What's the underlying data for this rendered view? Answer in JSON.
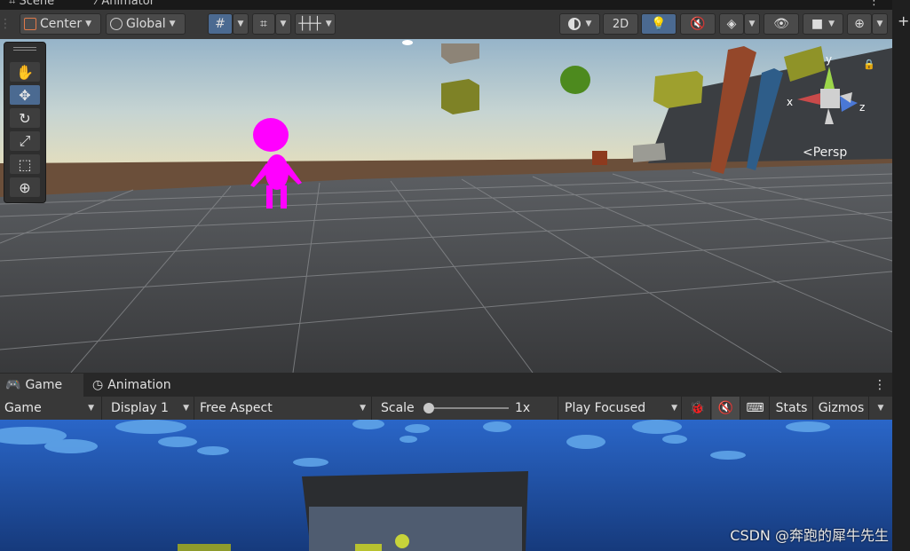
{
  "scene_tabs": {
    "scene_label": "Scene",
    "animator_label": "Animator"
  },
  "scene_toolbar": {
    "pivot_label": "Center",
    "space_label": "Global",
    "mode_2d_label": "2D"
  },
  "scene_view": {
    "projection_label": "Persp",
    "axes": {
      "x": "x",
      "y": "y",
      "z": "z"
    }
  },
  "game_tabs": {
    "game_label": "Game",
    "animation_label": "Animation"
  },
  "game_toolbar": {
    "view_select": "Game",
    "display_select": "Display 1",
    "aspect_select": "Free Aspect",
    "scale_label": "Scale",
    "scale_value_label": "1x",
    "scale_value": 0.0,
    "play_mode_select": "Play Focused",
    "stats_label": "Stats",
    "gizmos_label": "Gizmos"
  },
  "watermark": "CSDN @奔跑的犀牛先生",
  "colors": {
    "toolbar_bg": "#383838",
    "active_blue": "#4b6a91",
    "magenta_character": "#ff00ff",
    "game_sky": "#1b3f8a"
  },
  "icons": [
    "hand-icon",
    "move-icon",
    "rotate-icon",
    "scale-icon",
    "rect-icon",
    "transform-icon",
    "shading-icon",
    "light-icon",
    "audio-mute-icon",
    "effects-icon",
    "visibility-icon",
    "camera-icon",
    "gizmo-icon",
    "bug-icon",
    "keyboard-icon",
    "kebab-menu-icon"
  ]
}
